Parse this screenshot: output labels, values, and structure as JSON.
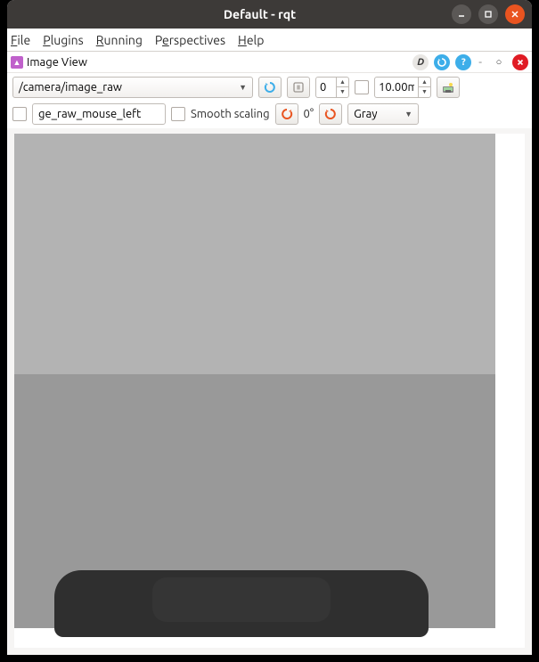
{
  "window": {
    "title": "Default - rqt"
  },
  "menubar": {
    "file": "File",
    "plugins": "Plugins",
    "running": "Running",
    "perspectives": "Perspectives",
    "help": "Help"
  },
  "panel": {
    "title": "Image View",
    "d_label": "D"
  },
  "toolbar1": {
    "topic": "/camera/image_raw",
    "num_value": "0",
    "max_value": "10.00m"
  },
  "toolbar2": {
    "mouse_text": "ge_raw_mouse_left",
    "smooth_label": "Smooth scaling",
    "rotation": "0°",
    "color_mode": "Gray"
  }
}
